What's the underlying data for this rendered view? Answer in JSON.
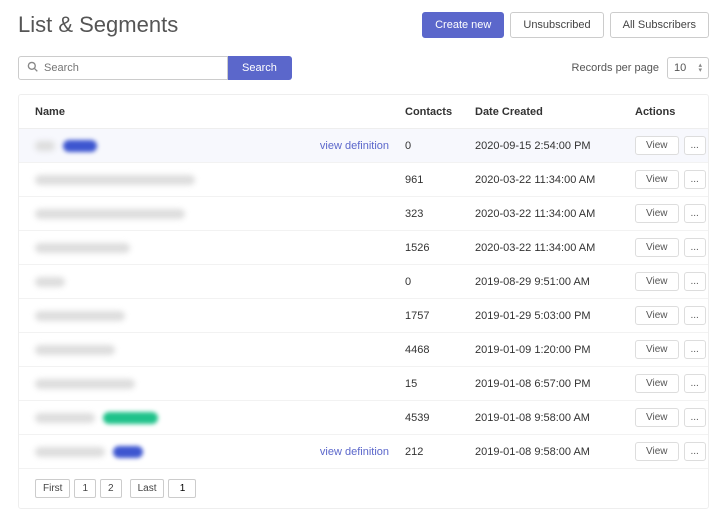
{
  "page_title": "List & Segments",
  "header_buttons": {
    "create": "Create new",
    "unsubscribed": "Unsubscribed",
    "all_subscribers": "All Subscribers"
  },
  "search": {
    "placeholder": "Search",
    "button": "Search"
  },
  "records_per_page": {
    "label": "Records per page",
    "value": "10"
  },
  "columns": {
    "name": "Name",
    "contacts": "Contacts",
    "date": "Date Created",
    "actions": "Actions"
  },
  "action_labels": {
    "view": "View",
    "more": "...",
    "view_definition": "view definition"
  },
  "rows": [
    {
      "highlight": true,
      "grey_w": 20,
      "badge": "blue",
      "badge_w": 34,
      "definition": true,
      "contacts": "0",
      "date": "2020-09-15 2:54:00 PM"
    },
    {
      "highlight": false,
      "grey_w": 160,
      "badge": null,
      "badge_w": 0,
      "definition": false,
      "contacts": "961",
      "date": "2020-03-22 11:34:00 AM"
    },
    {
      "highlight": false,
      "grey_w": 150,
      "badge": null,
      "badge_w": 0,
      "definition": false,
      "contacts": "323",
      "date": "2020-03-22 11:34:00 AM"
    },
    {
      "highlight": false,
      "grey_w": 95,
      "badge": null,
      "badge_w": 0,
      "definition": false,
      "contacts": "1526",
      "date": "2020-03-22 11:34:00 AM"
    },
    {
      "highlight": false,
      "grey_w": 30,
      "badge": null,
      "badge_w": 0,
      "definition": false,
      "contacts": "0",
      "date": "2019-08-29 9:51:00 AM"
    },
    {
      "highlight": false,
      "grey_w": 90,
      "badge": null,
      "badge_w": 0,
      "definition": false,
      "contacts": "1757",
      "date": "2019-01-29 5:03:00 PM"
    },
    {
      "highlight": false,
      "grey_w": 80,
      "badge": null,
      "badge_w": 0,
      "definition": false,
      "contacts": "4468",
      "date": "2019-01-09 1:20:00 PM"
    },
    {
      "highlight": false,
      "grey_w": 100,
      "badge": null,
      "badge_w": 0,
      "definition": false,
      "contacts": "15",
      "date": "2019-01-08 6:57:00 PM"
    },
    {
      "highlight": false,
      "grey_w": 60,
      "badge": "green",
      "badge_w": 55,
      "definition": false,
      "contacts": "4539",
      "date": "2019-01-08 9:58:00 AM"
    },
    {
      "highlight": false,
      "grey_w": 70,
      "badge": "blue",
      "badge_w": 30,
      "definition": true,
      "contacts": "212",
      "date": "2019-01-08 9:58:00 AM"
    }
  ],
  "pagination": {
    "first": "First",
    "pages": [
      "1",
      "2"
    ],
    "last": "Last",
    "current": "1"
  }
}
